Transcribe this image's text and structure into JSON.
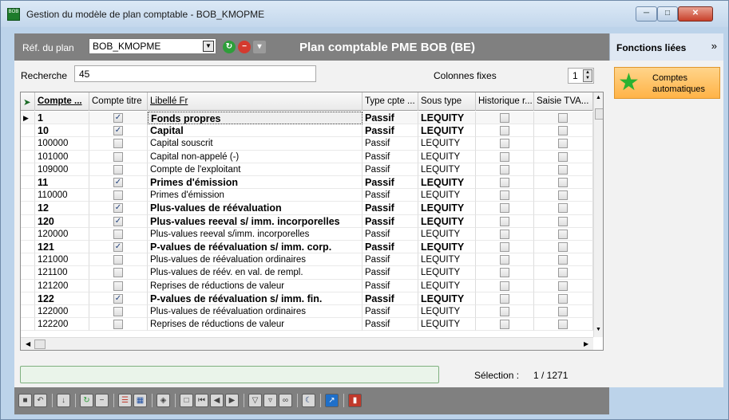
{
  "window": {
    "title": "Gestion du modèle de plan comptable - BOB_KMOPME",
    "icon_label": "BOB"
  },
  "toolbar": {
    "ref_label": "Réf. du plan",
    "ref_value": "BOB_KMOPME",
    "plan_title": "Plan comptable PME BOB (BE)"
  },
  "side": {
    "title": "Fonctions liées",
    "action_label": "Comptes automatiques"
  },
  "search": {
    "label": "Recherche",
    "value": "45",
    "cols_label": "Colonnes fixes",
    "cols_value": "1"
  },
  "grid": {
    "columns": [
      "Compte ...",
      "Compte titre",
      "Libellé Fr",
      "Type cpte ...",
      "Sous type",
      "Historique r...",
      "Saisie TVA..."
    ],
    "rows": [
      {
        "compte": "1",
        "titre": true,
        "libelle": "Fonds propres",
        "type": "Passif",
        "sous": "LEQUITY",
        "bold": true
      },
      {
        "compte": "10",
        "titre": true,
        "libelle": "Capital",
        "type": "Passif",
        "sous": "LEQUITY",
        "bold": true
      },
      {
        "compte": "100000",
        "titre": false,
        "libelle": "Capital souscrit",
        "type": "Passif",
        "sous": "LEQUITY",
        "bold": false
      },
      {
        "compte": "101000",
        "titre": false,
        "libelle": "Capital non-appelé (-)",
        "type": "Passif",
        "sous": "LEQUITY",
        "bold": false
      },
      {
        "compte": "109000",
        "titre": false,
        "libelle": "Compte de l'exploitant",
        "type": "Passif",
        "sous": "LEQUITY",
        "bold": false
      },
      {
        "compte": "11",
        "titre": true,
        "libelle": "Primes d'émission",
        "type": "Passif",
        "sous": "LEQUITY",
        "bold": true
      },
      {
        "compte": "110000",
        "titre": false,
        "libelle": "Primes d'émission",
        "type": "Passif",
        "sous": "LEQUITY",
        "bold": false
      },
      {
        "compte": "12",
        "titre": true,
        "libelle": "Plus-values de réévaluation",
        "type": "Passif",
        "sous": "LEQUITY",
        "bold": true
      },
      {
        "compte": "120",
        "titre": true,
        "libelle": "Plus-values reeval s/ imm. incorporelles",
        "type": "Passif",
        "sous": "LEQUITY",
        "bold": true
      },
      {
        "compte": "120000",
        "titre": false,
        "libelle": "Plus-values reeval s/imm. incorporelles",
        "type": "Passif",
        "sous": "LEQUITY",
        "bold": false
      },
      {
        "compte": "121",
        "titre": true,
        "libelle": "P-values de réévaluation s/ imm. corp.",
        "type": "Passif",
        "sous": "LEQUITY",
        "bold": true
      },
      {
        "compte": "121000",
        "titre": false,
        "libelle": "Plus-values de réévaluation ordinaires",
        "type": "Passif",
        "sous": "LEQUITY",
        "bold": false
      },
      {
        "compte": "121100",
        "titre": false,
        "libelle": "Plus-values de réév. en val. de rempl.",
        "type": "Passif",
        "sous": "LEQUITY",
        "bold": false
      },
      {
        "compte": "121200",
        "titre": false,
        "libelle": "Reprises de réductions de valeur",
        "type": "Passif",
        "sous": "LEQUITY",
        "bold": false
      },
      {
        "compte": "122",
        "titre": true,
        "libelle": "P-values de réévaluation s/ imm. fin.",
        "type": "Passif",
        "sous": "LEQUITY",
        "bold": true
      },
      {
        "compte": "122000",
        "titre": false,
        "libelle": "Plus-values de réévaluation ordinaires",
        "type": "Passif",
        "sous": "LEQUITY",
        "bold": false
      },
      {
        "compte": "122200",
        "titre": false,
        "libelle": "Reprises de réductions de valeur",
        "type": "Passif",
        "sous": "LEQUITY",
        "bold": false
      }
    ]
  },
  "status": {
    "selection_label": "Sélection :",
    "selection_value": "1 / 1271"
  }
}
